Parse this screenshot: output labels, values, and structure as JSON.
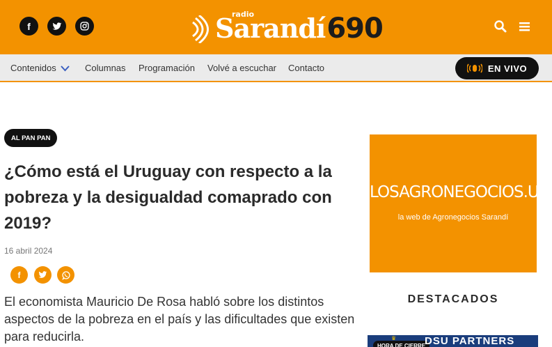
{
  "header": {
    "social": [
      {
        "name": "facebook-icon",
        "glyph": "f"
      },
      {
        "name": "twitter-icon",
        "glyph": ""
      },
      {
        "name": "instagram-icon",
        "glyph": ""
      }
    ],
    "logo": {
      "radio": "radio",
      "name": "Sarandí",
      "number": "690"
    },
    "colors": {
      "brand": "#f39200",
      "dark": "#111111"
    }
  },
  "nav": {
    "items": [
      "Contenidos",
      "Columnas",
      "Programación",
      "Volvé a escuchar",
      "Contacto"
    ],
    "live_label": "EN VIVO"
  },
  "article": {
    "category": "AL PAN PAN",
    "title": "¿Cómo está el Uruguay con respecto a la pobreza y la desigualdad comaprado con 2019?",
    "date": "16 abril 2024",
    "summary": "El economista Mauricio De Rosa habló sobre los distintos aspectos de la pobreza en el país y las dificultades que existen para reducirla."
  },
  "sidebar": {
    "ad": {
      "logo": "LOSAGRONEGOCIOS.UY",
      "subtitle": "la web de Agronegocios Sarandí"
    },
    "heading": "DESTACADOS",
    "promo": {
      "badge": "HORA DE CIERRE",
      "text": "DSU PARTNERS"
    }
  }
}
